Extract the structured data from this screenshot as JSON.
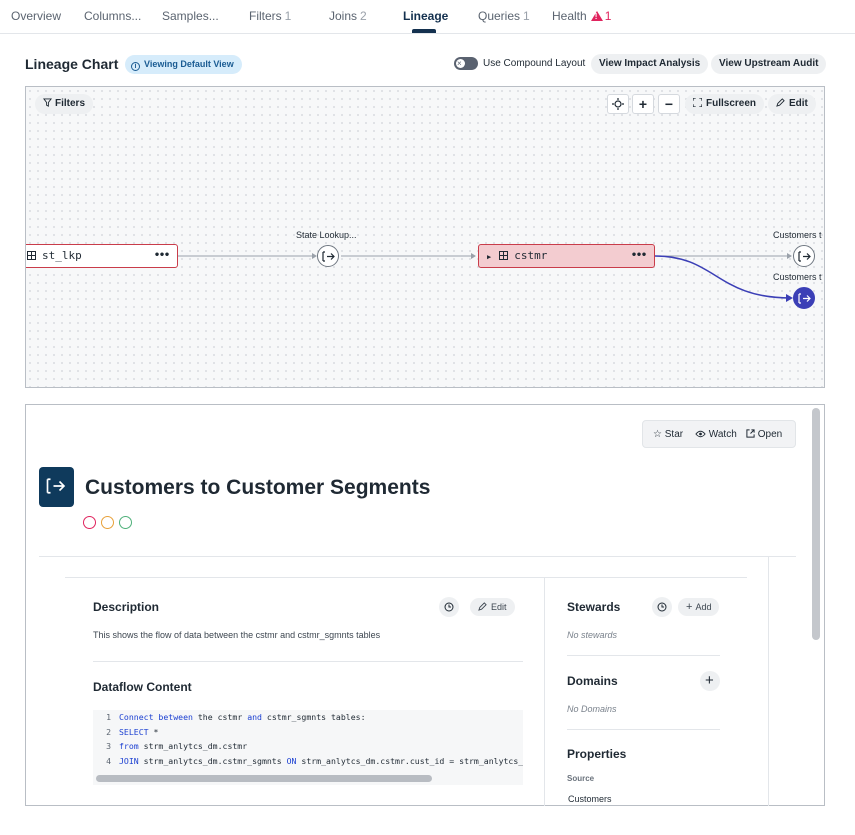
{
  "tabs": [
    {
      "label": "Overview",
      "count": ""
    },
    {
      "label": "Columns...",
      "count": ""
    },
    {
      "label": "Samples...",
      "count": ""
    },
    {
      "label": "Filters",
      "count": "1"
    },
    {
      "label": "Joins",
      "count": "2"
    },
    {
      "label": "Lineage",
      "count": ""
    },
    {
      "label": "Queries",
      "count": "1"
    },
    {
      "label": "Health",
      "count": "1"
    }
  ],
  "lineage": {
    "title": "Lineage Chart",
    "badge": "Viewing Default View",
    "toggle_label": "Use Compound Layout",
    "impact_button": "View Impact Analysis",
    "upstream_button": "View Upstream Audit"
  },
  "canvas": {
    "filters_button": "Filters",
    "zoom_in": "+",
    "zoom_out": "−",
    "fullscreen_button": "Fullscreen",
    "edit_button": "Edit",
    "nodes": [
      {
        "label": "st_lkp"
      },
      {
        "label": "cstmr"
      }
    ],
    "process_labels": [
      "State Lookup...",
      "Customers t",
      "Customers t"
    ],
    "dots": "•••"
  },
  "detail": {
    "actions": {
      "star": "Star",
      "watch": "Watch",
      "open": "Open"
    },
    "title": "Customers to Customer Segments",
    "status_colors": [
      "#e0245e",
      "#e8a13a",
      "#4fb07a"
    ],
    "description": {
      "heading": "Description",
      "edit": "Edit",
      "text": "This shows the flow of data between the cstmr and cstmr_sgmnts tables"
    },
    "dataflow": {
      "heading": "Dataflow Content",
      "lines": [
        {
          "no": "1",
          "parts": [
            {
              "t": "Connect between",
              "k": true
            },
            {
              "t": " the cstmr ",
              "k": false
            },
            {
              "t": "and",
              "k": true
            },
            {
              "t": " cstmr_sgmnts tables:",
              "k": false
            }
          ]
        },
        {
          "no": "2",
          "parts": [
            {
              "t": "SELECT",
              "k": true
            },
            {
              "t": " *",
              "k": false
            }
          ]
        },
        {
          "no": "3",
          "parts": [
            {
              "t": "from",
              "k": true
            },
            {
              "t": " strm_anlytcs_dm.cstmr",
              "k": false
            }
          ]
        },
        {
          "no": "4",
          "parts": [
            {
              "t": "JOIN",
              "k": true
            },
            {
              "t": " strm_anlytcs_dm.cstmr_sgmnts ",
              "k": false
            },
            {
              "t": "ON",
              "k": true
            },
            {
              "t": " strm_anlytcs_dm.cstmr.cust_id = strm_anlytcs_dm",
              "k": false
            }
          ]
        }
      ]
    },
    "stewards": {
      "heading": "Stewards",
      "add": "Add",
      "empty": "No stewards"
    },
    "domains": {
      "heading": "Domains",
      "empty": "No Domains"
    },
    "properties": {
      "heading": "Properties",
      "source_label": "Source",
      "source_value": "Customers"
    }
  }
}
